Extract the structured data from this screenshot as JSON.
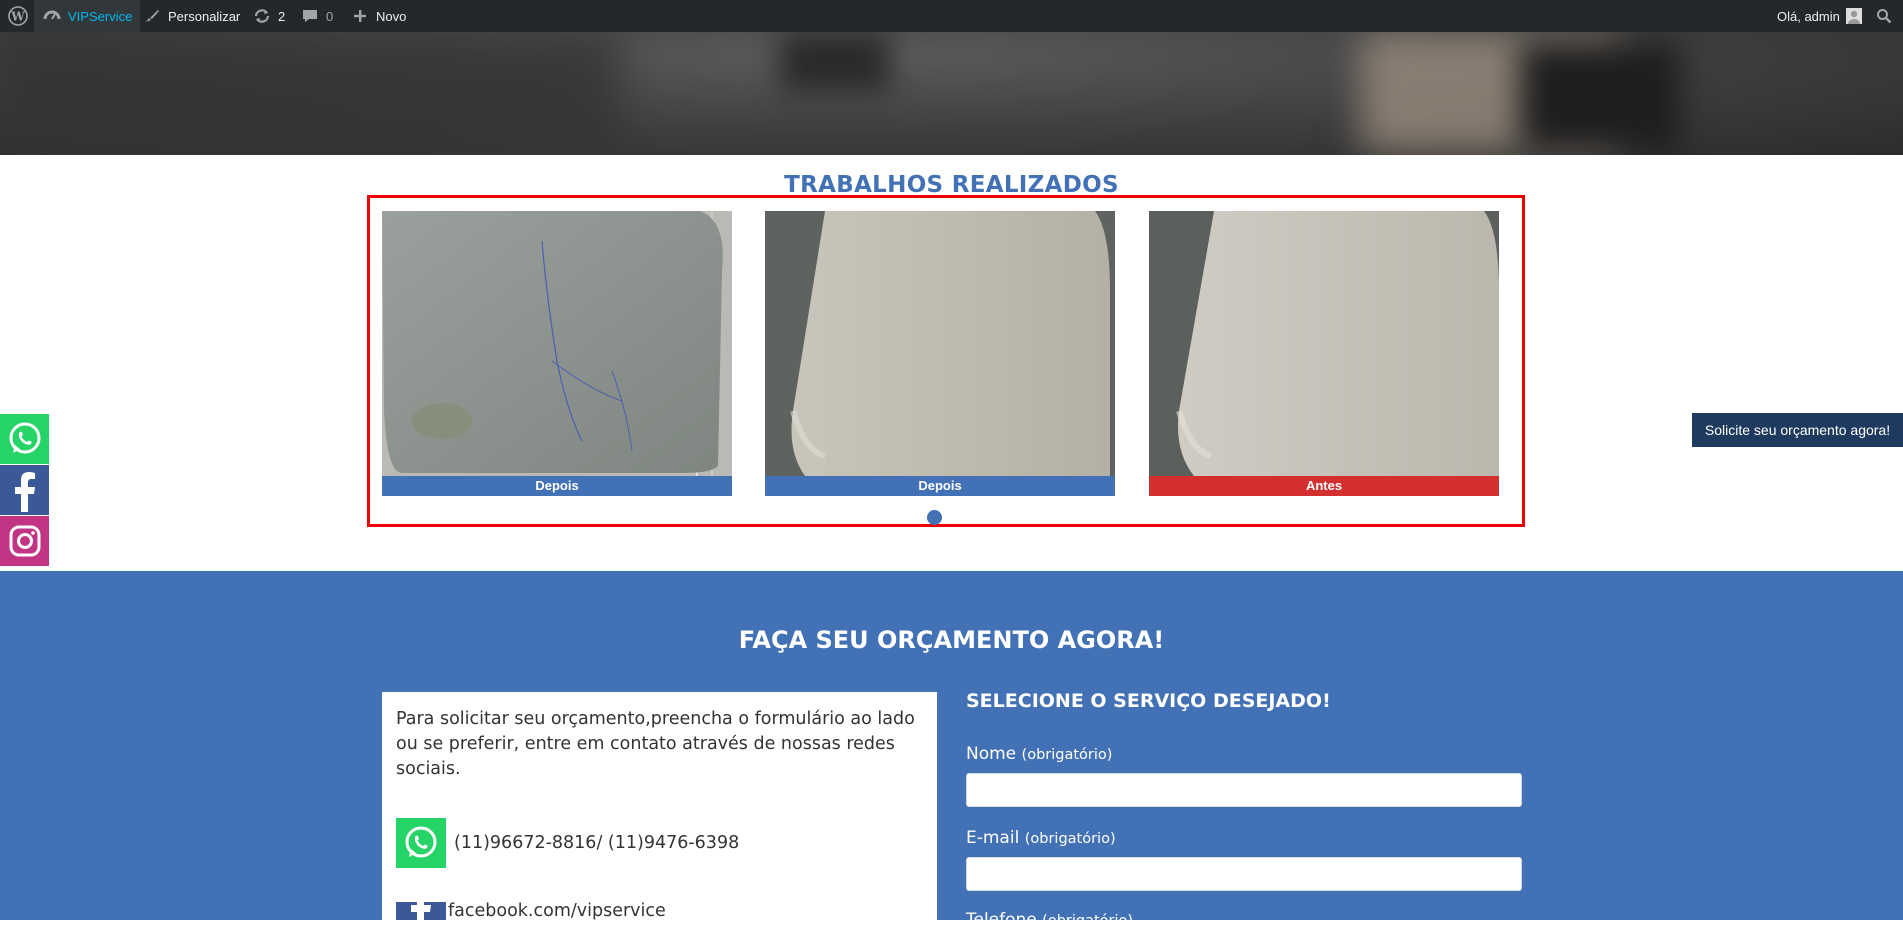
{
  "adminbar": {
    "site_name": "VIPService",
    "customize": "Personalizar",
    "updates_count": "2",
    "comments_count": "0",
    "new_label": "Novo",
    "greeting": "Olá, admin"
  },
  "works": {
    "title": "TRABALHOS REALIZADOS",
    "slides": [
      {
        "caption": "Depois",
        "color": "#4271b5"
      },
      {
        "caption": "Depois",
        "color": "#4271b5"
      },
      {
        "caption": "Antes",
        "color": "#d32f2f"
      }
    ]
  },
  "floating_cta": "Solicite seu orçamento agora!",
  "social_sidebar": [
    {
      "icon": "whatsapp-icon",
      "color": "#25d366"
    },
    {
      "icon": "facebook-icon",
      "color": "#3b5998"
    },
    {
      "icon": "instagram-icon",
      "color": "#c13584"
    }
  ],
  "quote": {
    "title": "FAÇA SEU ORÇAMENTO AGORA!",
    "intro": "Para solicitar seu orçamento,preencha o formulário ao lado ou se preferir, entre em contato através de nossas redes sociais.",
    "phone": "(11)96672-8816/ (11)9476-6398",
    "facebook": "facebook.com/vipservice"
  },
  "form": {
    "title": "SELECIONE O SERVIÇO DESEJADO!",
    "name_label": "Nome",
    "email_label": "E-mail",
    "phone_label": "Telefone",
    "required": "(obrigatório)"
  }
}
